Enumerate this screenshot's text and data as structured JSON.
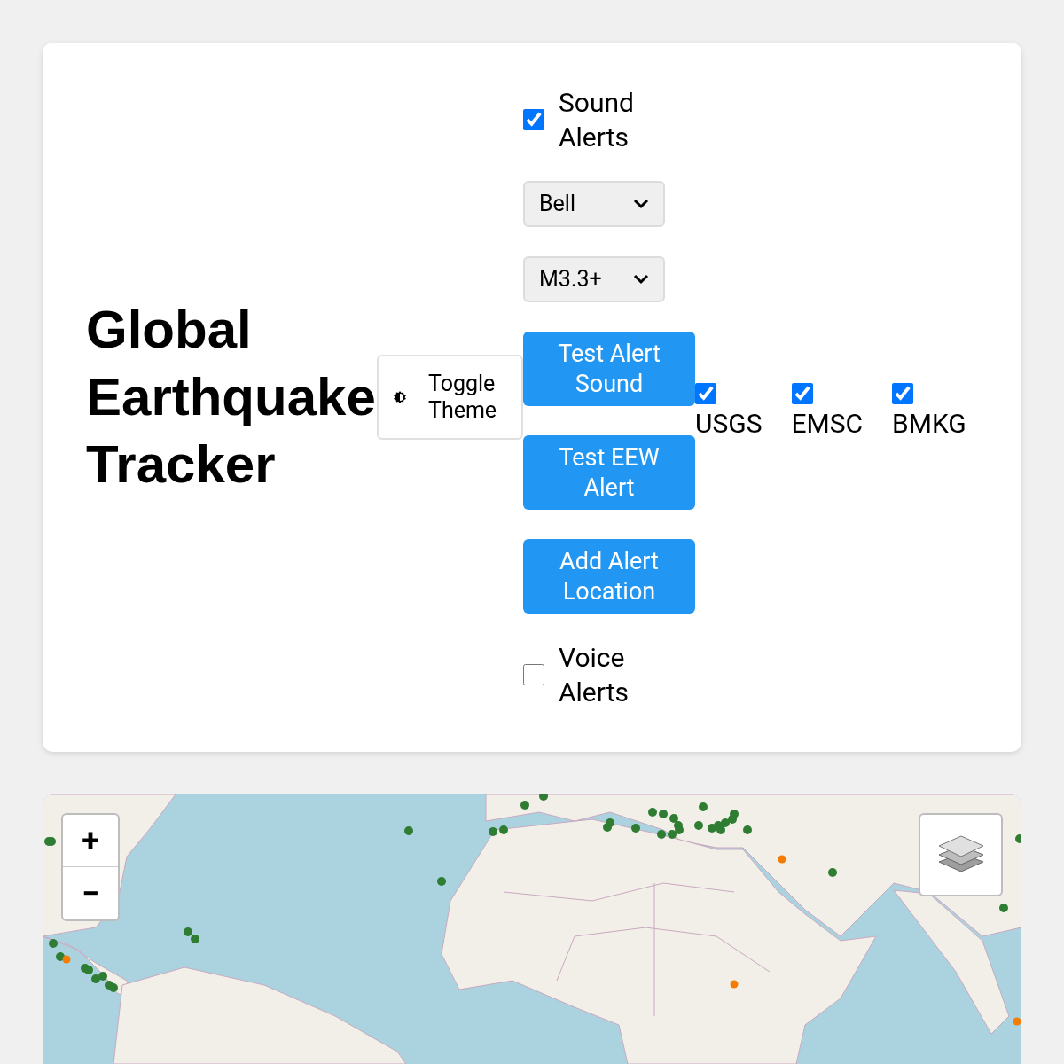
{
  "title": "Global Earthquake Tracker",
  "theme_button": {
    "label": "Toggle Theme"
  },
  "sound_alerts": {
    "label": "Sound Alerts",
    "checked": true
  },
  "sound_select": {
    "value": "Bell"
  },
  "magnitude_select": {
    "value": "M3.3+"
  },
  "buttons": [
    "Test Alert Sound",
    "Test EEW Alert",
    "Add Alert Location"
  ],
  "voice_alerts": {
    "label": "Voice Alerts",
    "checked": false
  },
  "sources": [
    {
      "label": "USGS",
      "checked": true
    },
    {
      "label": "EMSC",
      "checked": true
    },
    {
      "label": "BMKG",
      "checked": true
    }
  ],
  "map": {
    "zoom_in": "+",
    "zoom_out": "−"
  }
}
